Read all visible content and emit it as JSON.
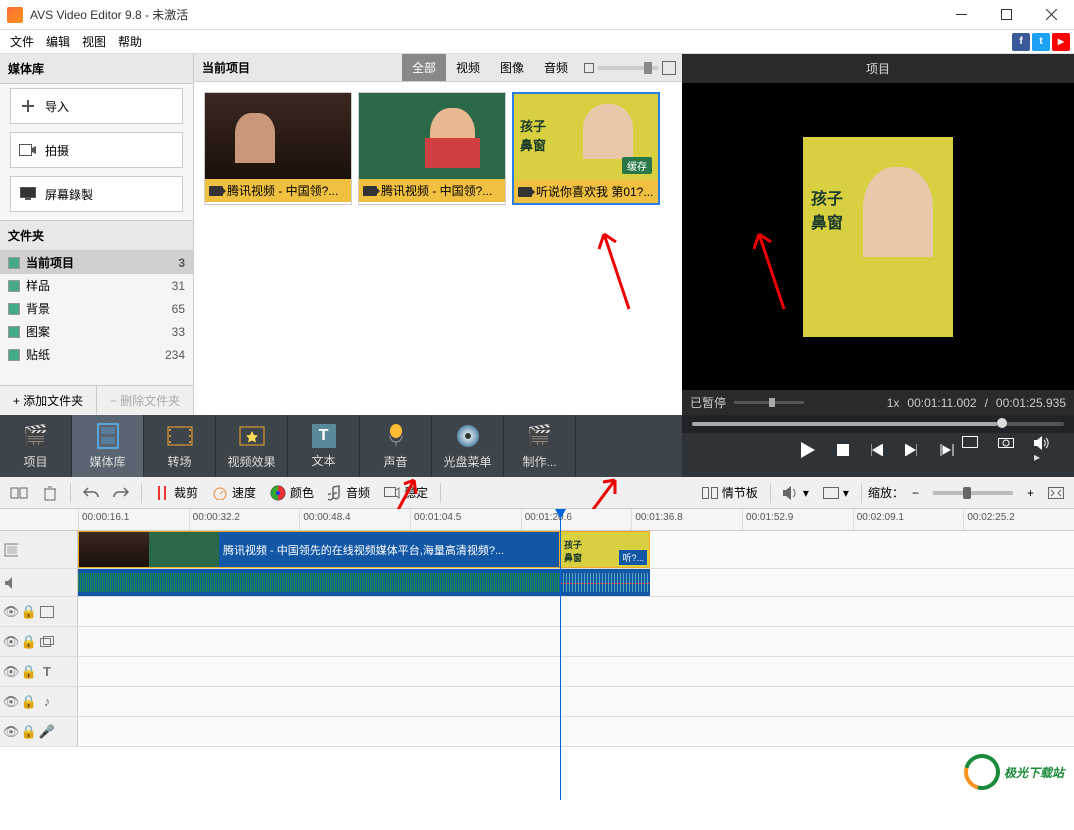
{
  "titlebar": {
    "title": "AVS Video Editor 9.8 - 未激活"
  },
  "menu": {
    "file": "文件",
    "edit": "编辑",
    "view": "视图",
    "help": "帮助"
  },
  "social": {
    "fb": "f",
    "tw": "t",
    "yt": "▶"
  },
  "leftpanel": {
    "media_lib": "媒体库",
    "import": "导入",
    "capture": "拍摄",
    "screenrec": "屏幕錄製",
    "folders_hdr": "文件夹",
    "add_folder": "添加文件夹",
    "del_folder": "删除文件夹",
    "folders": [
      {
        "name": "当前项目",
        "count": "3",
        "selected": true
      },
      {
        "name": "样品",
        "count": "31"
      },
      {
        "name": "背景",
        "count": "65"
      },
      {
        "name": "图案",
        "count": "33"
      },
      {
        "name": "贴纸",
        "count": "234"
      }
    ]
  },
  "center": {
    "title": "当前项目",
    "tabs": {
      "all": "全部",
      "video": "视频",
      "image": "图像",
      "audio": "音频"
    },
    "thumbs": [
      {
        "label": "腾讯视频 - 中国领?..."
      },
      {
        "label": "腾讯视频 - 中国领?..."
      },
      {
        "label": "听说你喜欢我 第01?...",
        "t3_title": "孩子\n鼻窗",
        "cache": "缓存",
        "selected": true
      }
    ]
  },
  "preview": {
    "title": "项目",
    "paused": "已暂停",
    "speed": "1x",
    "current": "00:01:11.002",
    "total": "00:01:25.935",
    "t3_title": "孩子\n鼻窗"
  },
  "tabs": {
    "project": "项目",
    "media": "媒体库",
    "transition": "转场",
    "effects": "视频效果",
    "text": "文本",
    "audio": "声音",
    "disc": "光盘菜单",
    "produce": "制作..."
  },
  "tools": {
    "crop": "裁剪",
    "speed": "速度",
    "color": "颜色",
    "audio": "音频",
    "stable": "稳定",
    "storyboard": "情节板",
    "zoom": "缩放："
  },
  "timeline": {
    "ticks": [
      "00:00:16.1",
      "00:00:32.2",
      "00:00:48.4",
      "00:01:04.5",
      "00:01:20.6",
      "00:01:36.8",
      "00:01:52.9",
      "00:02:09.1",
      "00:02:25.2"
    ],
    "clip1_text": "腾讯视频 - 中国领先的在线视频媒体平台,海量高清视频?...",
    "clip2_text": "孩子\n鼻窗",
    "clip2_label": "听?..."
  },
  "watermark": "极光下载站"
}
